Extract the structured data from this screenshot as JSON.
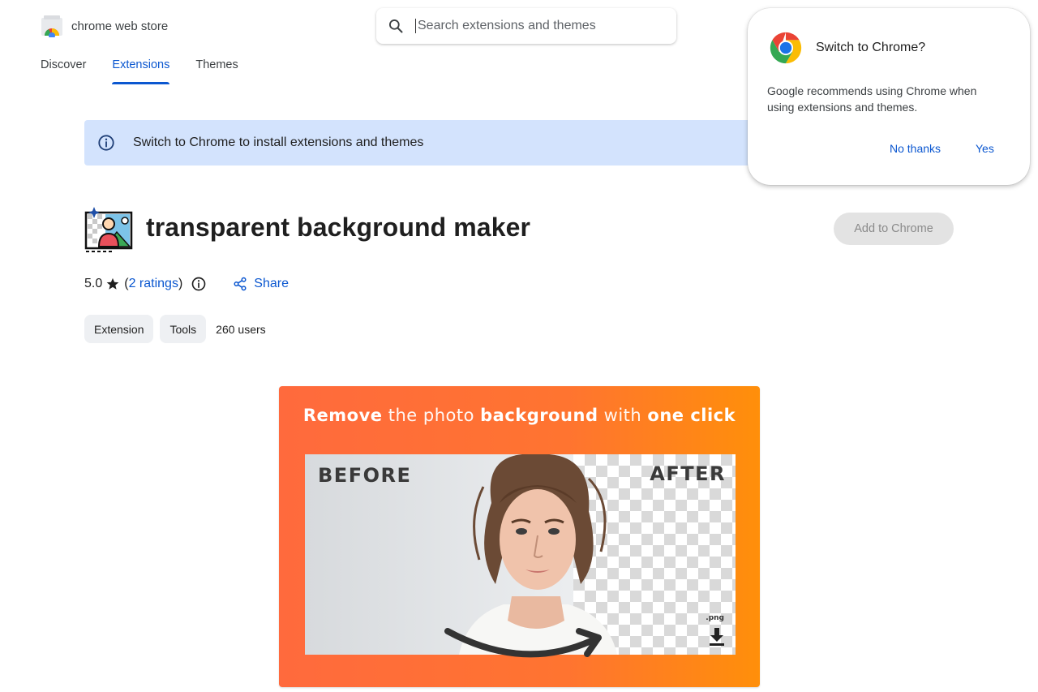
{
  "header": {
    "logo_text": "chrome web store",
    "search_placeholder": "Search extensions and themes"
  },
  "nav": {
    "items": [
      {
        "label": "Discover",
        "active": false
      },
      {
        "label": "Extensions",
        "active": true
      },
      {
        "label": "Themes",
        "active": false
      }
    ]
  },
  "banner": {
    "text": "Switch to Chrome to install extensions and themes",
    "icon": "info-icon"
  },
  "item": {
    "title": "transparent background maker",
    "add_button": "Add to Chrome",
    "rating_value": "5.0",
    "rating_open": "(",
    "ratings_link": "2 ratings",
    "rating_close": ")",
    "share_label": "Share",
    "chips": [
      "Extension",
      "Tools"
    ],
    "users": "260 users"
  },
  "screenshot": {
    "headline": {
      "part1": "Remove",
      "part2": " the photo ",
      "part3": "background",
      "part4": " with ",
      "part5": "one click"
    },
    "before_label": "BEFORE",
    "after_label": "AFTER",
    "png_label": ".png"
  },
  "popup": {
    "title": "Switch to Chrome?",
    "body": "Google recommends using Chrome when using extensions and themes.",
    "no_button": "No thanks",
    "yes_button": "Yes"
  },
  "colors": {
    "accent": "#0b57d0",
    "banner_bg": "#d3e3fd",
    "promo_orange": "#ff6a3d",
    "promo_orange_end": "#ff8f0a"
  }
}
